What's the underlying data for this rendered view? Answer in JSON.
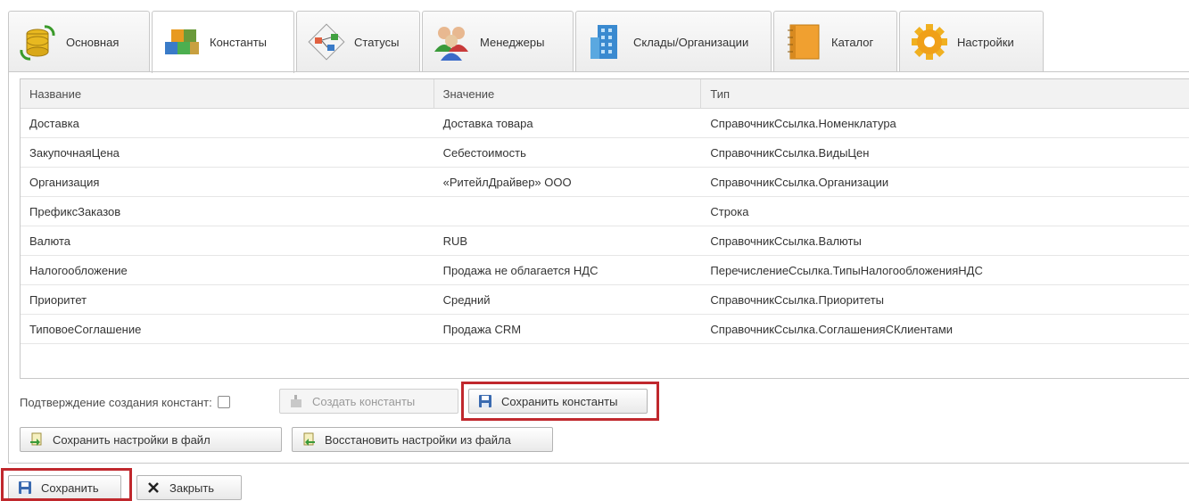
{
  "tabs": [
    {
      "label": "Основная",
      "icon": "database-sync-icon"
    },
    {
      "label": "Константы",
      "icon": "cubes-icon"
    },
    {
      "label": "Статусы",
      "icon": "workflow-icon"
    },
    {
      "label": "Менеджеры",
      "icon": "people-icon"
    },
    {
      "label": "Склады/Организации",
      "icon": "building-icon"
    },
    {
      "label": "Каталог",
      "icon": "catalog-icon"
    },
    {
      "label": "Настройки",
      "icon": "gear-icon"
    }
  ],
  "active_tab": "Константы",
  "table": {
    "columns": [
      "Название",
      "Значение",
      "Тип"
    ],
    "rows": [
      [
        "Доставка",
        "Доставка товара",
        "СправочникСсылка.Номенклатура"
      ],
      [
        "ЗакупочнаяЦена",
        "Себестоимость",
        "СправочникСсылка.ВидыЦен"
      ],
      [
        "Организация",
        "«РитейлДрайвер» ООО",
        "СправочникСсылка.Организации"
      ],
      [
        "ПрефиксЗаказов",
        "",
        "Строка"
      ],
      [
        "Валюта",
        "RUB",
        "СправочникСсылка.Валюты"
      ],
      [
        "Налогообложение",
        "Продажа не облагается НДС",
        "ПеречислениеСсылка.ТипыНалогообложенияНДС"
      ],
      [
        "Приоритет",
        "Средний",
        "СправочникСсылка.Приоритеты"
      ],
      [
        "ТиповоеСоглашение",
        "Продажа CRM",
        "СправочникСсылка.СоглашенияСКлиентами"
      ]
    ]
  },
  "controls": {
    "confirm_label": "Подтверждение создания констант:",
    "confirm_checked": false,
    "create_constants": "Создать константы",
    "save_constants": "Сохранить константы",
    "save_settings_file": "Сохранить настройки в файл",
    "restore_settings_file": "Восстановить настройки из файла"
  },
  "footer": {
    "save": "Сохранить",
    "close": "Закрыть"
  },
  "colors": {
    "highlight": "#c0282d",
    "border": "#c8c8c8"
  }
}
